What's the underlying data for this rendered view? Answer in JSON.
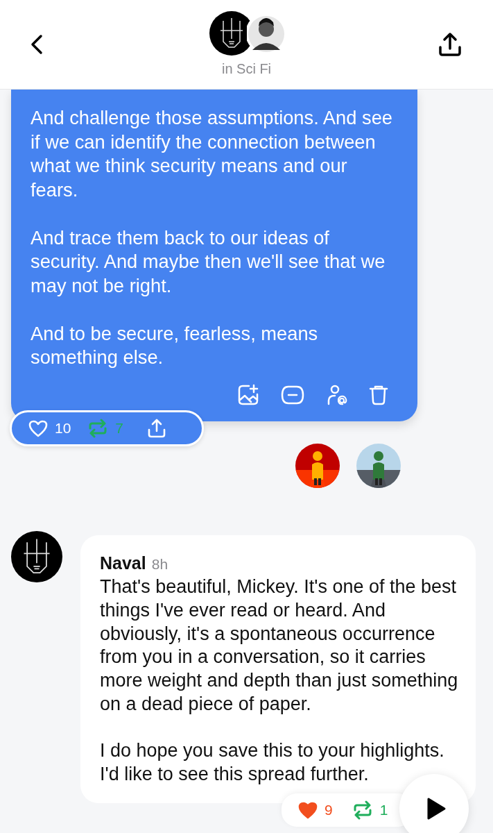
{
  "header": {
    "subtitle": "in Sci Fi"
  },
  "own_message": {
    "paragraphs": [
      "And challenge those assumptions. And see if we can identify the connection between what we think security means and our fears.",
      "And trace them back to our ideas of security. And maybe then we'll see that we may not be right.",
      "And to be secure, fearless, means something else."
    ],
    "reactions": {
      "likes": "10",
      "liked": false,
      "reposts": "7",
      "reposted": true
    }
  },
  "reply": {
    "author": "Naval",
    "time": "8h",
    "paragraphs": [
      "That's beautiful, Mickey. It's one of the best things I've ever read or heard. And obviously, it's a spontaneous occurrence from you in a conversation, so it carries more weight and depth than just something on a dead piece of paper.",
      "I do hope you save this to your highlights. I'd like to see this spread further."
    ],
    "reactions": {
      "likes": "9",
      "liked": true,
      "reposts": "1",
      "reposted": true
    }
  }
}
